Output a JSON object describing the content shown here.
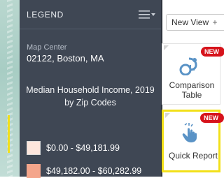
{
  "legend": {
    "title": "LEGEND",
    "map_center_label": "Map Center",
    "map_center_value": "02122, Boston, MA",
    "data_title": "Median Household Income, 2019 by Zip Codes",
    "items": [
      {
        "range": "$0.00 - $49,181.99",
        "color": "#fde5dc"
      },
      {
        "range": "$49,182.00 - $60,282.99",
        "color": "#f4a58b"
      }
    ]
  },
  "toolbar": {
    "new_view_label": "New View",
    "plus_glyph": "+"
  },
  "cards": [
    {
      "label": "Comparison Table",
      "badge": "NEW",
      "icon": "comparison-icon"
    },
    {
      "label": "Quick Report",
      "badge": "NEW",
      "icon": "hand-pointer-icon"
    }
  ],
  "colors": {
    "panel_bg": "#3f4754",
    "highlight_yellow": "#f2e01a",
    "badge_red": "#d6131b",
    "icon_blue": "#5a93c6"
  }
}
